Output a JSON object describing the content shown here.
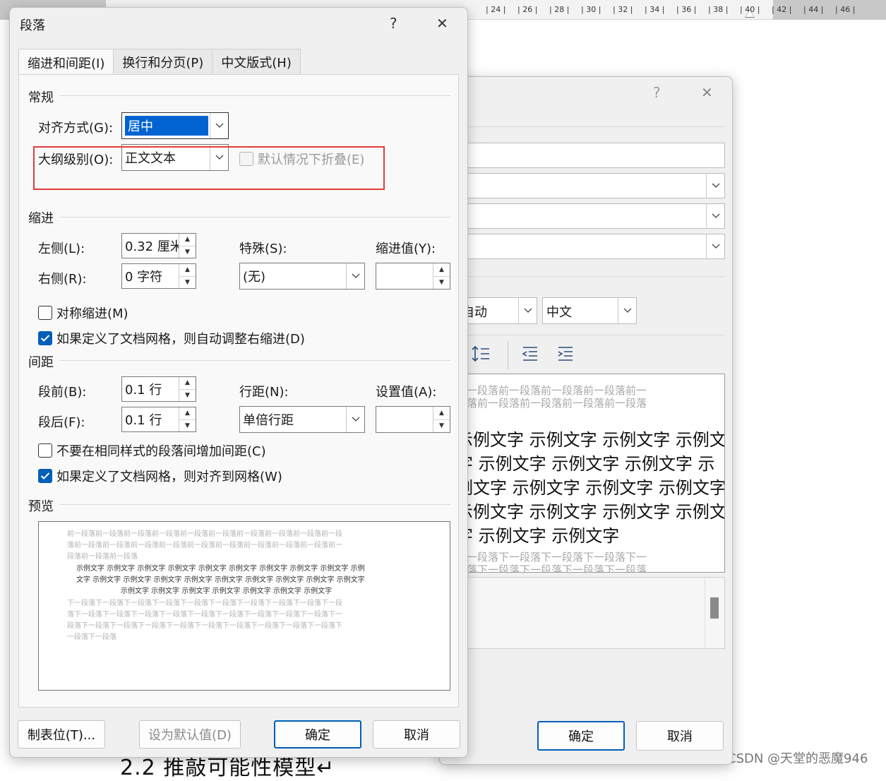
{
  "ruler": {
    "numbers": [
      "| 24 |",
      "| 26 |",
      "| 28 |",
      "| 30 |",
      "| 32 |",
      "| 34 |",
      "| 36 |",
      "| 38 |",
      "| 40 |",
      "| 42 |",
      "| 44 |",
      "| 46 |"
    ]
  },
  "document": {
    "heading": "2.2 推敲可能性模型↵",
    "watermark": "CSDN @天堂的恶魔946"
  },
  "back_dialog": {
    "help": "?",
    "close": "✕",
    "combo1_text": "自动",
    "combo2_text": "中文",
    "preview": {
      "before_lines": [
        "前一段落前一段落前一段落前一段落前一",
        "段落前一段落前一段落前一段落前一段落"
      ],
      "sample_lines": [
        "示例文字  示例文字  示例文字  示例文",
        "字  示例文字  示例文字  示例文字  示",
        "例文字  示例文字  示例文字  示例文字",
        "示例文字  示例文字  示例文字  示例文",
        "字  示例文字  示例文字"
      ],
      "after_lines": [
        "下一段落下一段落下一段落下一段落下一",
        "段落下一段落下一段落下一段落下一段落"
      ]
    },
    "ok": "确定",
    "cancel": "取消"
  },
  "dialog": {
    "title": "段落",
    "help": "?",
    "close": "✕",
    "tabs": [
      "缩进和间距(I)",
      "换行和分页(P)",
      "中文版式(H)"
    ],
    "general": {
      "heading": "常规",
      "alignment_label": "对齐方式(G):",
      "alignment_value": "居中",
      "outline_label": "大纲级别(O):",
      "outline_value": "正文文本",
      "collapse_label": "默认情况下折叠(E)"
    },
    "indent": {
      "heading": "缩进",
      "left_label": "左侧(L):",
      "left_value": "0.32 厘米",
      "right_label": "右侧(R):",
      "right_value": "0 字符",
      "special_label": "特殊(S):",
      "special_value": "(无)",
      "by_label": "缩进值(Y):",
      "by_value": "",
      "mirror_label": "对称缩进(M)",
      "auto_adjust_label": "如果定义了文档网格，则自动调整右缩进(D)"
    },
    "spacing": {
      "heading": "间距",
      "before_label": "段前(B):",
      "before_value": "0.1 行",
      "after_label": "段后(F):",
      "after_value": "0.1 行",
      "line_label": "行距(N):",
      "line_value": "单倍行距",
      "at_label": "设置值(A):",
      "at_value": "",
      "no_space_label": "不要在相同样式的段落间增加间距(C)",
      "snap_grid_label": "如果定义了文档网格，则对齐到网格(W)"
    },
    "preview": {
      "heading": "预览",
      "before_lines": [
        "前一段落前一段落前一段落前一段落前一段落前一段落前一段落前一段落前一段落前一段",
        "落前一段落前一段落前一段落前一段落前一段落前一段落前一段落前一段落前一段落前一",
        "段落前一段落前一段落"
      ],
      "sample_lines": [
        "示例文字  示例文字  示例文字  示例文字  示例文字  示例文字  示例文字  示例文字  示例文字  示例",
        "文字  示例文字  示例文字  示例文字  示例文字  示例文字  示例文字  示例文字  示例文字  示例文字",
        "示例文字  示例文字  示例文字  示例文字  示例文字  示例文字  示例文字"
      ],
      "after_lines": [
        "下一段落下一段落下一段落下一段落下一段落下一段落下一段落下一段落下一段落下一段",
        "落下一段落下一段落下一段落下一段落下一段落下一段落下一段落下一段落下一段落下一",
        "段落下一段落下一段落下一段落下一段落下一段落下一段落下一段落下一段落下一段落下",
        "一段落下一段落"
      ]
    },
    "buttons": {
      "tabs": "制表位(T)...",
      "set_default": "设为默认值(D)",
      "ok": "确定",
      "cancel": "取消"
    }
  }
}
